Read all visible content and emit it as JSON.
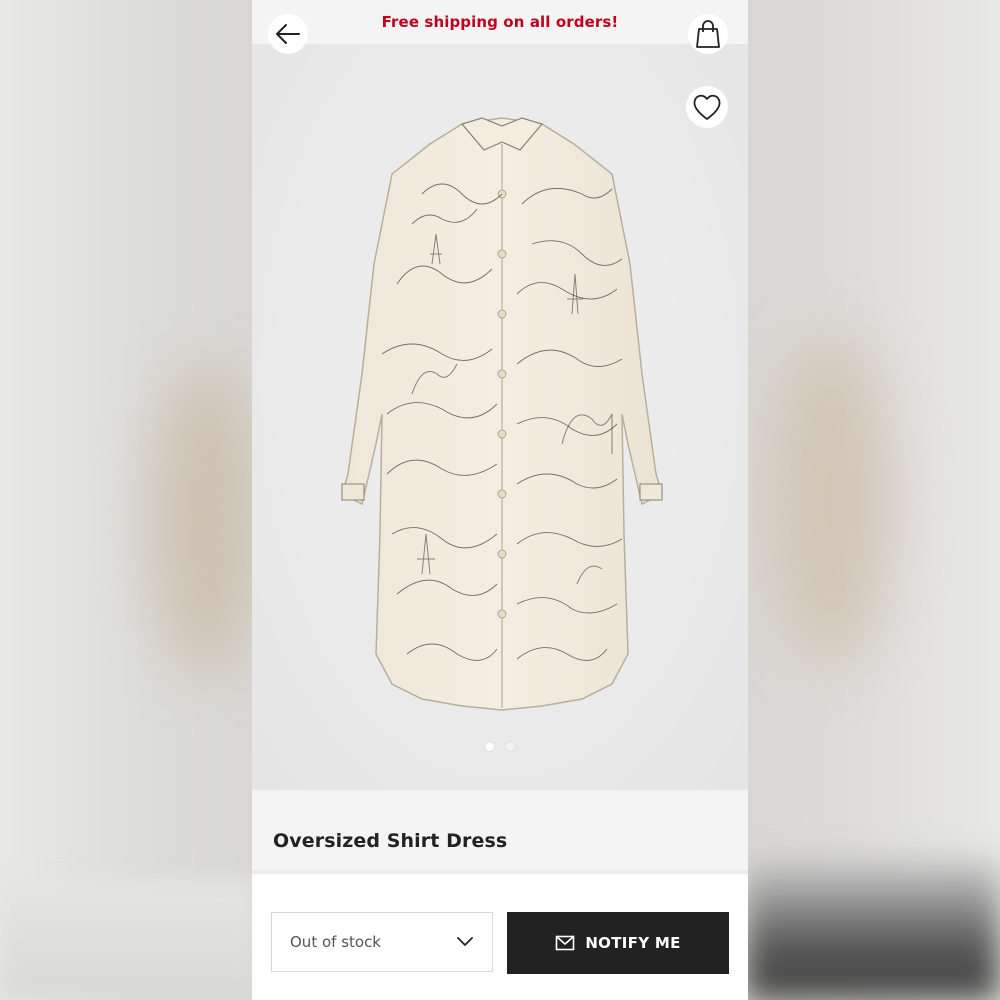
{
  "promo": {
    "text": "Free shipping on all orders!"
  },
  "header": {
    "back_icon": "arrow-left-icon",
    "bag_icon": "shopping-bag-icon"
  },
  "product": {
    "title": "Oversized Shirt Dress",
    "wishlist_icon": "heart-icon",
    "image_alt": "Cream shirt dress with black landscape toile print",
    "carousel": {
      "total": 2,
      "current": 1
    }
  },
  "purchase": {
    "size_select_value": "Out of stock",
    "notify_label": "NOTIFY ME",
    "notify_icon": "envelope-icon"
  },
  "colors": {
    "promo_red": "#c1001f",
    "button_dark": "#222222"
  }
}
